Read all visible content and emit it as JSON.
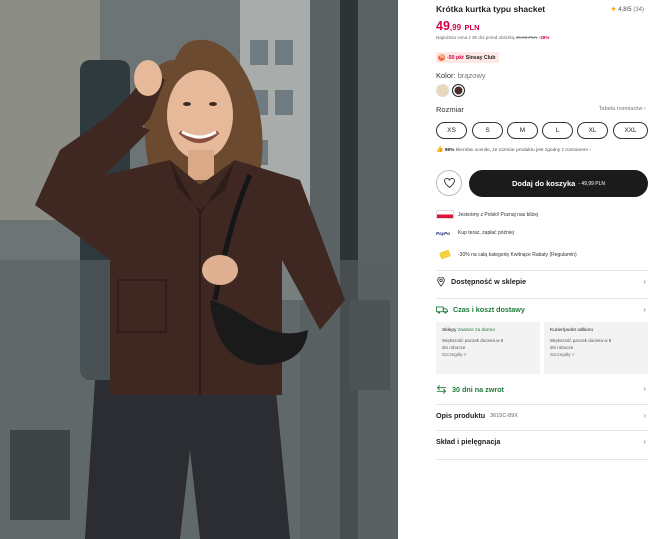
{
  "product": {
    "title": "Krótka kurtka typu shacket",
    "rating_value": "4,8/5",
    "rating_count": "(34)",
    "price_main": "49",
    "price_decimal": ",99",
    "price_currency": "PLN",
    "lowest_price_text": "Najniższa cena z 30 dni przed obniżką",
    "lowest_price_old": "49,99 PLN",
    "lowest_price_pct": "-29%",
    "club_badge_icon": "%",
    "club_badge_discount": "-50 pkt",
    "club_badge_label": "Sinsay Club"
  },
  "color": {
    "label": "Kolor:",
    "value": "brązowy",
    "swatches": [
      "#e9d7b9",
      "#4a2e26"
    ]
  },
  "size": {
    "label": "Rozmiar",
    "table_link": "Tabela rozmiarów",
    "options": [
      "XS",
      "S",
      "M",
      "L",
      "XL",
      "XXL"
    ],
    "fit_pct": "95%",
    "fit_text": "klientów oceniło, że rozmiar produktu jest zgodny z rozmiarem"
  },
  "actions": {
    "cart_label": "Dodaj do koszyka",
    "cart_price": "- 49,99 PLN"
  },
  "info": {
    "origin": "Jesteśmy z Polski! Poznaj nas bliżej",
    "paypo_logo": "PayPo",
    "paypo": "Kup teraz, zapłać później",
    "discount": "-30% na całą kategorię Kwitnące Rabaty (Regulamin)"
  },
  "sections": {
    "store": "Dostępność w sklepie",
    "delivery": "Czas i koszt dostawy",
    "returns": "30 dni na zwrot",
    "description_label": "Opis produktu",
    "description_code": "3615C-89X",
    "care": "Skład i pielęgnacja"
  },
  "delivery_cards": [
    {
      "head": "Sklepy",
      "highlight": "zawsze za darmo",
      "body1": "Większość paczek dociera w 8",
      "body2": "dni robocze",
      "more": "Szczegóły >"
    },
    {
      "head": "Kurier/punkt odbioru",
      "highlight": "",
      "body1": "Większość paczek dociera w 8",
      "body2": "dni robocze",
      "more": "Szczegóły >"
    }
  ],
  "colors": {
    "price": "#d3004c",
    "accent_green": "#1f7a3a",
    "cart_bg": "#1b1b1b"
  }
}
